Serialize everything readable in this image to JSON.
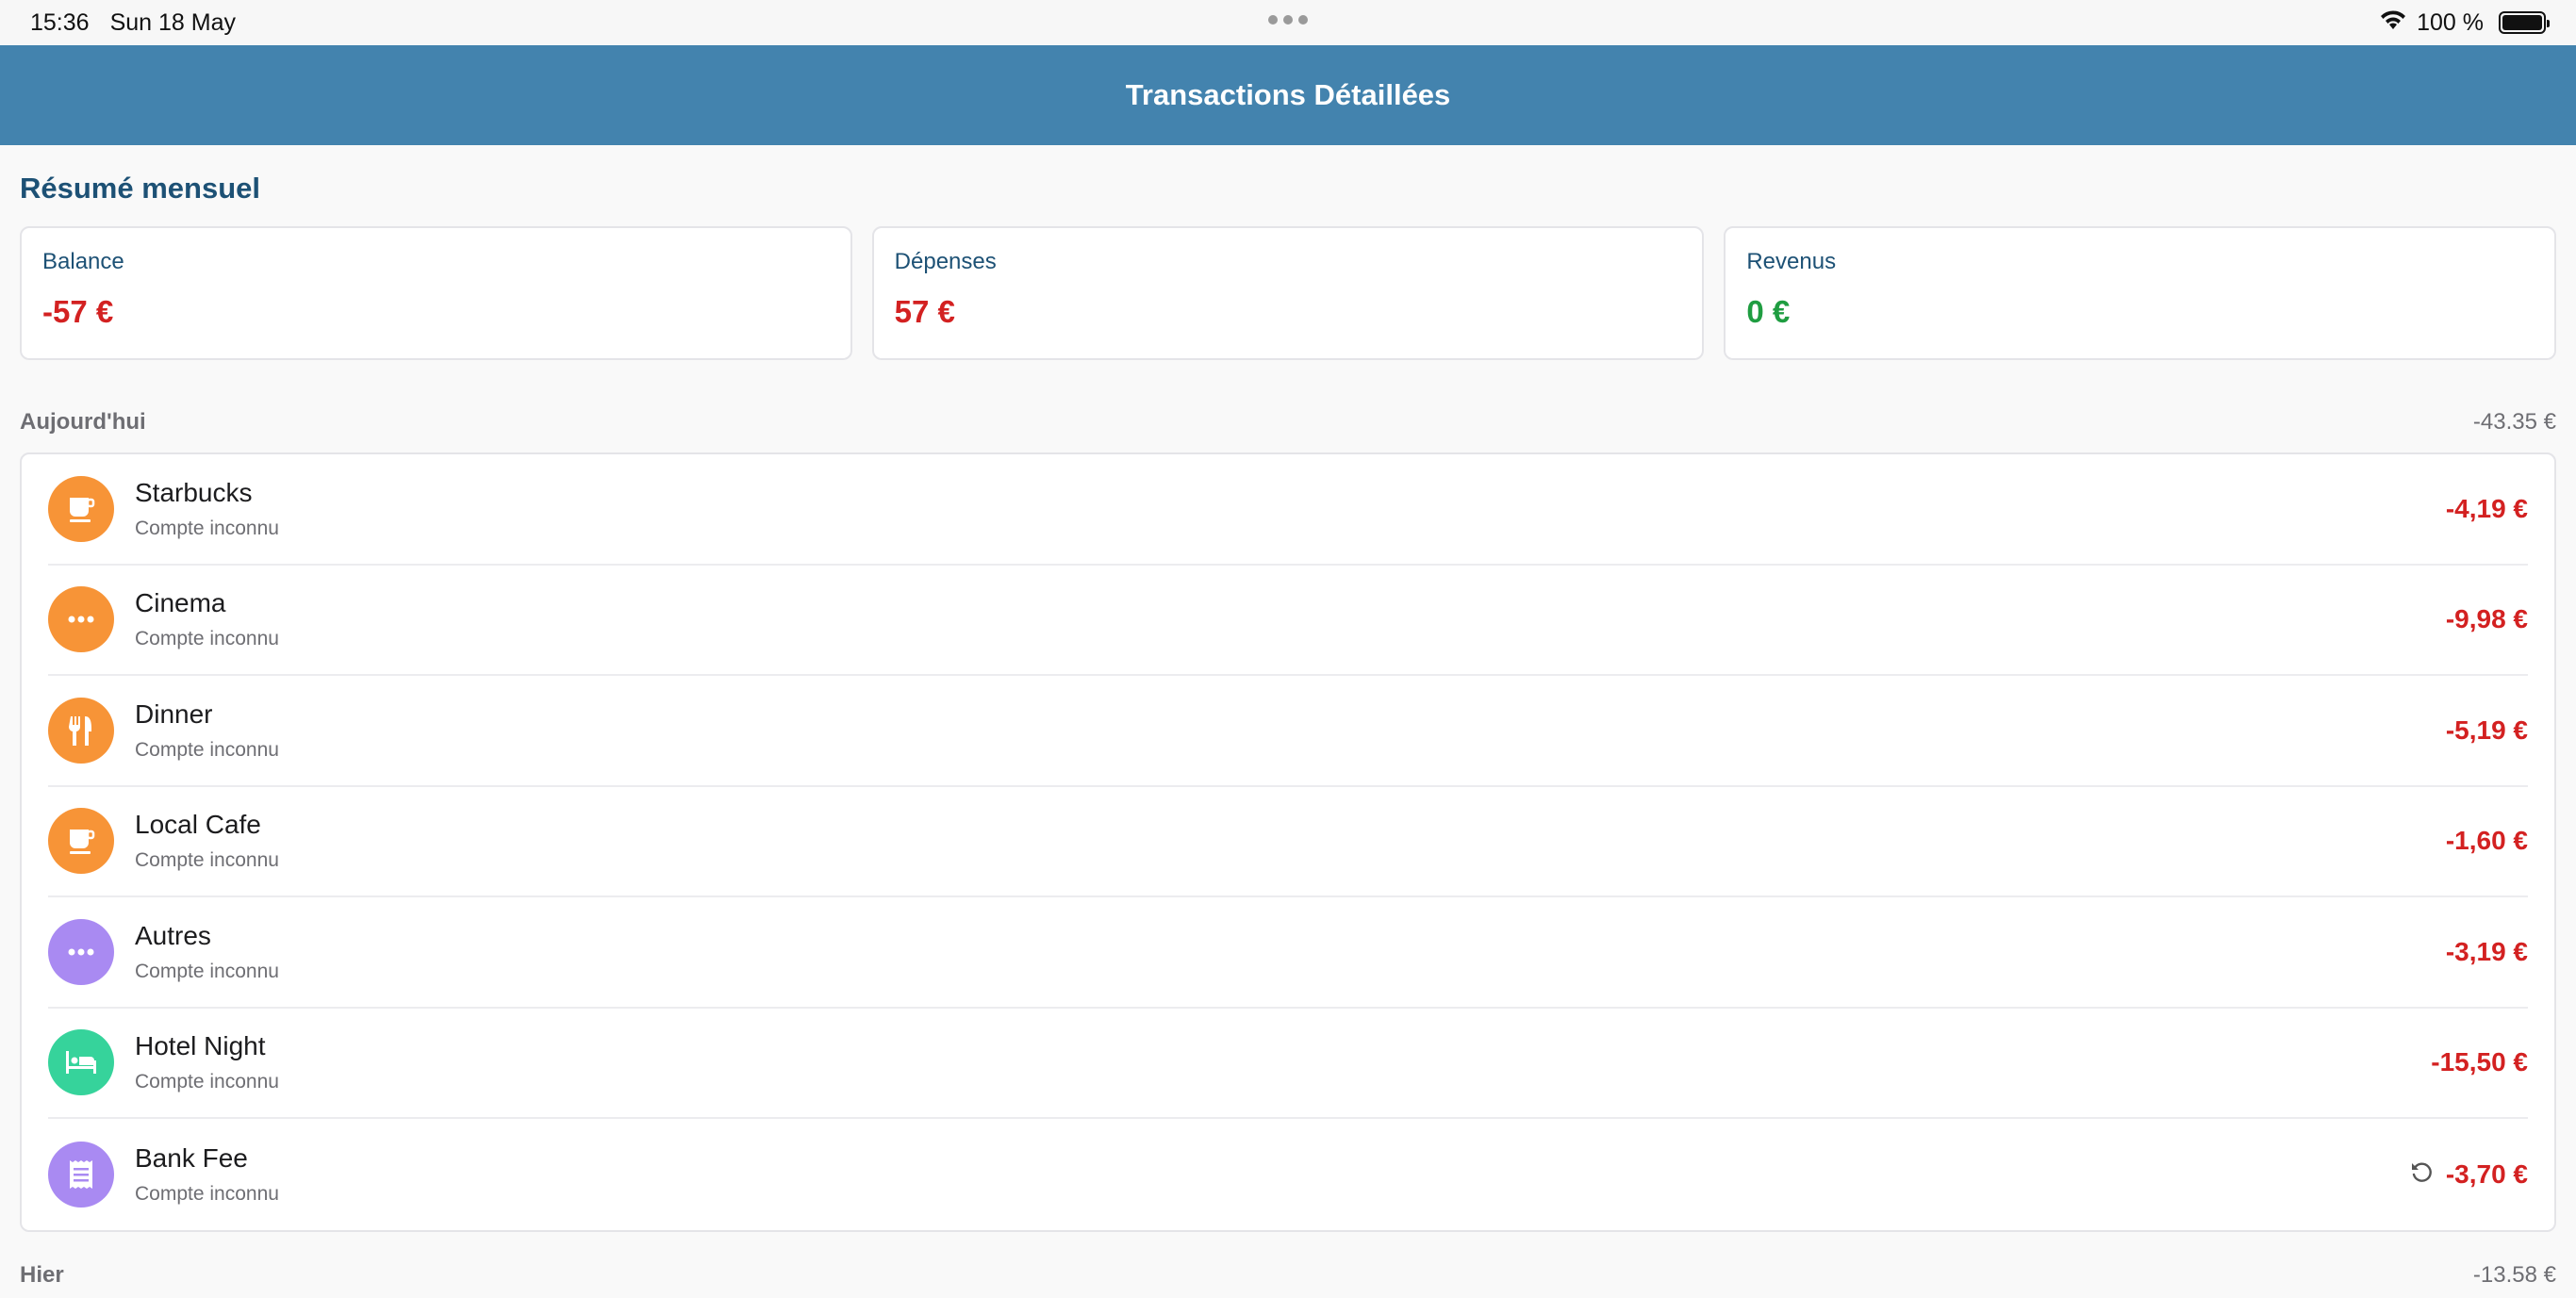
{
  "status_bar": {
    "time": "15:36",
    "date": "Sun 18 May",
    "battery": "100 %",
    "battery_level": 1.0
  },
  "nav": {
    "title": "Transactions Détaillées"
  },
  "summary": {
    "title": "Résumé mensuel",
    "cards": [
      {
        "label": "Balance",
        "value": "-57 €",
        "tone": "neg"
      },
      {
        "label": "Dépenses",
        "value": "57 €",
        "tone": "neg"
      },
      {
        "label": "Revenus",
        "value": "0 €",
        "tone": "pos"
      }
    ]
  },
  "today": {
    "label": "Aujourd'hui",
    "total": "-43.35 €",
    "transactions": [
      {
        "name": "Starbucks",
        "account": "Compte inconnu",
        "amount": "-4,19 €",
        "icon": "coffee-icon",
        "color": "#f79437"
      },
      {
        "name": "Cinema",
        "account": "Compte inconnu",
        "amount": "-9,98 €",
        "icon": "more-icon",
        "color": "#f79437"
      },
      {
        "name": "Dinner",
        "account": "Compte inconnu",
        "amount": "-5,19 €",
        "icon": "fork-knife-icon",
        "color": "#f79437"
      },
      {
        "name": "Local Cafe",
        "account": "Compte inconnu",
        "amount": "-1,60 €",
        "icon": "coffee-icon",
        "color": "#f79437"
      },
      {
        "name": "Autres",
        "account": "Compte inconnu",
        "amount": "-3,19 €",
        "icon": "more-icon",
        "color": "#a98af2"
      },
      {
        "name": "Hotel Night",
        "account": "Compte inconnu",
        "amount": "-15,50 €",
        "icon": "bed-icon",
        "color": "#36d39b"
      },
      {
        "name": "Bank Fee",
        "account": "Compte inconnu",
        "amount": "-3,70 €",
        "icon": "receipt-icon",
        "color": "#a98af2",
        "recurring_icon": "recurring-icon"
      }
    ]
  },
  "yesterday": {
    "label": "Hier",
    "total": "-13.58 €"
  }
}
